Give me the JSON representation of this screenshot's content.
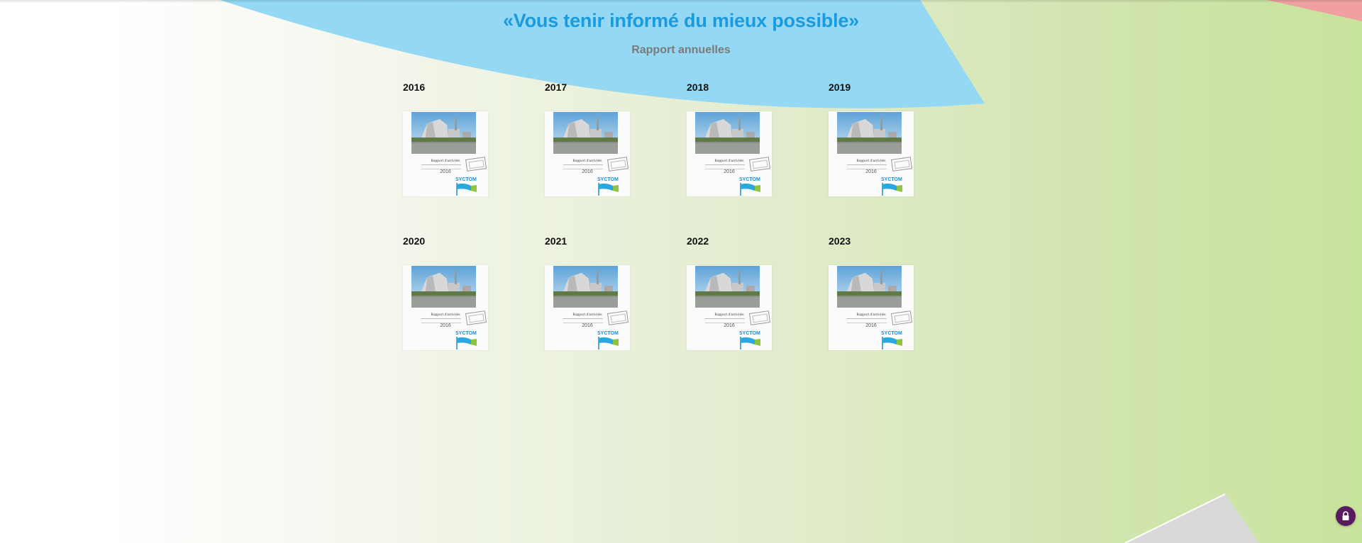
{
  "header": {
    "title": "«Vous tenir informé du mieux possible»",
    "subtitle": "Rapport annuelles"
  },
  "reports": [
    {
      "year": "2016",
      "cover_title": "Rapport d'activités",
      "cover_year": "2016",
      "cover_logo": "SYCTOM"
    },
    {
      "year": "2017",
      "cover_title": "Rapport d'activités",
      "cover_year": "2016",
      "cover_logo": "SYCTOM"
    },
    {
      "year": "2018",
      "cover_title": "Rapport d'activités",
      "cover_year": "2016",
      "cover_logo": "SYCTOM"
    },
    {
      "year": "2019",
      "cover_title": "Rapport d'activités",
      "cover_year": "2016",
      "cover_logo": "SYCTOM"
    },
    {
      "year": "2020",
      "cover_title": "Rapport d'activités",
      "cover_year": "2016",
      "cover_logo": "SYCTOM"
    },
    {
      "year": "2021",
      "cover_title": "Rapport d'activités",
      "cover_year": "2016",
      "cover_logo": "SYCTOM"
    },
    {
      "year": "2022",
      "cover_title": "Rapport d'activités",
      "cover_year": "2016",
      "cover_logo": "SYCTOM"
    },
    {
      "year": "2023",
      "cover_title": "Rapport d'activités",
      "cover_year": "2016",
      "cover_logo": "SYCTOM"
    }
  ],
  "colors": {
    "accent_blue": "#1a9be0",
    "arc_blue": "#94d8f3",
    "corner_red": "#f0a0a0",
    "lock_purple": "#5a1a5e"
  },
  "icons": {
    "privacy_button": "lock-icon"
  }
}
